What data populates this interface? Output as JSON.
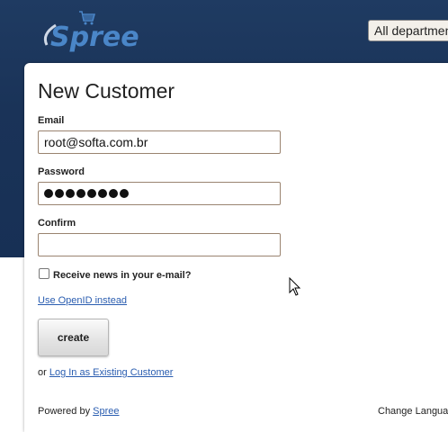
{
  "header": {
    "logo_text": "Spree",
    "department_select": "All departments"
  },
  "form": {
    "title": "New Customer",
    "email_label": "Email",
    "email_value": "root@softa.com.br",
    "password_label": "Password",
    "password_mask_count": 8,
    "confirm_label": "Confirm",
    "confirm_value": "",
    "newsletter_label": "Receive news in your e-mail?",
    "newsletter_checked": false,
    "openid_link": "Use OpenID instead",
    "create_button": "create",
    "or_text": "or",
    "login_link": "Log In as Existing Customer"
  },
  "footer": {
    "powered_by": "Powered by",
    "spree_link": "Spree",
    "change_language": "Change Language"
  },
  "colors": {
    "header_bg": "#1d3557",
    "link": "#2a5db0",
    "input_border": "#9a8470",
    "logo": "#4a86c8"
  },
  "icons": [
    "cart-icon",
    "mouse-cursor-icon"
  ]
}
